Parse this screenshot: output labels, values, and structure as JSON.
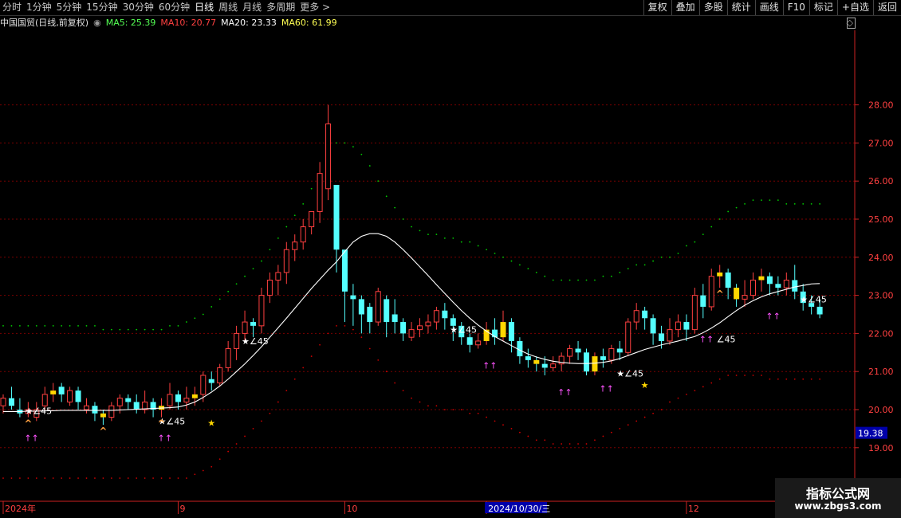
{
  "toolbar": {
    "periods": [
      "分时",
      "1分钟",
      "5分钟",
      "15分钟",
      "30分钟",
      "60分钟",
      "日线",
      "周线",
      "月线",
      "多周期",
      "更多 >"
    ],
    "active_index": 6,
    "tools": [
      "复权",
      "叠加",
      "多股",
      "统计",
      "画线",
      "F10",
      "标记",
      "+自选",
      "返回"
    ]
  },
  "info": {
    "stock": "中国国贸(日线,前复权)",
    "ma5": "MA5: 25.39",
    "ma10": "MA10: 20.77",
    "ma20": "MA20: 23.33",
    "ma60": "MA60: 61.99"
  },
  "watermark": {
    "line1": "指标公式网",
    "line2": "www.zbgs3.com"
  },
  "colors": {
    "up": "#ff4040",
    "down": "#54ffff",
    "ma": "#ffffff",
    "upper": "#00cc00",
    "lower": "#cc0000",
    "gold": "#ffd700"
  },
  "chart_data": {
    "type": "candlestick",
    "yaxis": {
      "ticks": [
        19,
        20,
        21,
        22,
        23,
        24,
        25,
        26,
        27,
        28
      ],
      "side": "right"
    },
    "current_price": "19.38",
    "xaxis_labels": [
      {
        "label": "2024年",
        "index": 0
      },
      {
        "label": "9",
        "index": 21
      },
      {
        "label": "10",
        "index": 41
      },
      {
        "label": "2024/10/30/三",
        "index": 58,
        "highlight": true
      },
      {
        "label": "12",
        "index": 82
      }
    ],
    "candles": [
      [
        20.1,
        20.3,
        19.9,
        20.4
      ],
      [
        20.3,
        20.1,
        20.0,
        20.6
      ],
      [
        20.0,
        19.9,
        19.8,
        20.3
      ],
      [
        19.9,
        20.0,
        19.8,
        20.2
      ],
      [
        19.8,
        20.0,
        19.7,
        20.2
      ],
      [
        20.1,
        20.4,
        20.0,
        20.6
      ],
      [
        20.4,
        20.5,
        20.2,
        20.7
      ],
      [
        20.6,
        20.4,
        20.2,
        20.7
      ],
      [
        20.2,
        20.5,
        20.1,
        20.6
      ],
      [
        20.5,
        20.2,
        20.0,
        20.6
      ],
      [
        20.0,
        20.1,
        19.9,
        20.3
      ],
      [
        20.1,
        19.9,
        19.7,
        20.2
      ],
      [
        19.9,
        19.8,
        19.6,
        20.0
      ],
      [
        19.8,
        20.1,
        19.7,
        20.2
      ],
      [
        20.1,
        20.3,
        19.9,
        20.4
      ],
      [
        20.3,
        20.2,
        20.0,
        20.4
      ],
      [
        20.2,
        20.0,
        19.9,
        20.4
      ],
      [
        20.0,
        20.2,
        19.9,
        20.5
      ],
      [
        20.2,
        20.0,
        19.8,
        20.3
      ],
      [
        20.0,
        20.1,
        19.8,
        20.3
      ],
      [
        20.1,
        20.4,
        20.0,
        20.7
      ],
      [
        20.4,
        20.2,
        20.0,
        20.5
      ],
      [
        20.2,
        20.3,
        20.0,
        20.6
      ],
      [
        20.3,
        20.4,
        20.1,
        20.6
      ],
      [
        20.4,
        20.9,
        20.2,
        21.0
      ],
      [
        20.8,
        20.7,
        20.5,
        21.0
      ],
      [
        20.7,
        21.1,
        20.6,
        21.2
      ],
      [
        21.1,
        21.6,
        21.0,
        21.8
      ],
      [
        21.6,
        22.0,
        21.3,
        22.2
      ],
      [
        22.0,
        22.3,
        21.8,
        22.6
      ],
      [
        22.3,
        22.2,
        21.9,
        22.4
      ],
      [
        22.2,
        23.0,
        22.0,
        23.2
      ],
      [
        23.0,
        23.4,
        22.8,
        23.6
      ],
      [
        23.4,
        23.6,
        23.0,
        23.8
      ],
      [
        23.6,
        24.2,
        23.3,
        24.4
      ],
      [
        24.2,
        24.4,
        23.9,
        24.6
      ],
      [
        24.4,
        24.8,
        24.2,
        25.0
      ],
      [
        24.8,
        25.2,
        24.6,
        25.2
      ],
      [
        25.2,
        26.2,
        24.9,
        26.5
      ],
      [
        25.8,
        27.5,
        25.5,
        28.0
      ],
      [
        25.9,
        24.2,
        23.6,
        25.4
      ],
      [
        24.2,
        23.1,
        22.3,
        23.5
      ],
      [
        23.0,
        22.9,
        22.2,
        23.3
      ],
      [
        22.9,
        22.5,
        22.0,
        23.0
      ],
      [
        22.7,
        22.3,
        22.0,
        22.8
      ],
      [
        22.3,
        23.1,
        22.2,
        23.2
      ],
      [
        22.9,
        22.3,
        21.9,
        23.0
      ],
      [
        22.5,
        22.3,
        22.0,
        22.9
      ],
      [
        22.3,
        22.0,
        21.8,
        22.4
      ],
      [
        21.9,
        22.1,
        21.8,
        22.3
      ],
      [
        22.1,
        22.2,
        21.9,
        22.4
      ],
      [
        22.2,
        22.3,
        22.0,
        22.5
      ],
      [
        22.3,
        22.6,
        22.1,
        22.7
      ],
      [
        22.6,
        22.4,
        22.1,
        22.8
      ],
      [
        22.4,
        22.2,
        21.8,
        22.5
      ],
      [
        22.2,
        21.9,
        21.7,
        22.3
      ],
      [
        21.9,
        21.7,
        21.5,
        22.0
      ],
      [
        21.7,
        21.8,
        21.6,
        22.0
      ],
      [
        21.8,
        22.1,
        21.7,
        22.3
      ],
      [
        22.1,
        21.9,
        21.7,
        22.4
      ],
      [
        21.9,
        22.3,
        21.8,
        22.6
      ],
      [
        22.3,
        21.8,
        21.5,
        22.4
      ],
      [
        21.8,
        21.4,
        21.2,
        21.9
      ],
      [
        21.4,
        21.3,
        21.1,
        21.6
      ],
      [
        21.3,
        21.2,
        21.0,
        21.4
      ],
      [
        21.2,
        21.1,
        20.9,
        21.4
      ],
      [
        21.1,
        21.2,
        21.0,
        21.4
      ],
      [
        21.2,
        21.4,
        21.0,
        21.5
      ],
      [
        21.4,
        21.6,
        21.2,
        21.7
      ],
      [
        21.6,
        21.5,
        21.3,
        21.8
      ],
      [
        21.5,
        21.0,
        20.9,
        21.6
      ],
      [
        21.0,
        21.4,
        20.9,
        21.5
      ],
      [
        21.4,
        21.3,
        21.1,
        21.6
      ],
      [
        21.3,
        21.6,
        21.2,
        21.7
      ],
      [
        21.6,
        21.5,
        21.3,
        21.8
      ],
      [
        21.5,
        22.3,
        21.4,
        22.4
      ],
      [
        22.3,
        22.6,
        22.1,
        22.8
      ],
      [
        22.6,
        22.4,
        22.1,
        22.7
      ],
      [
        22.4,
        22.0,
        21.7,
        22.5
      ],
      [
        22.0,
        21.8,
        21.6,
        22.2
      ],
      [
        21.8,
        22.1,
        21.7,
        22.4
      ],
      [
        22.1,
        22.3,
        21.9,
        22.5
      ],
      [
        22.3,
        22.1,
        21.8,
        22.5
      ],
      [
        22.1,
        23.0,
        22.0,
        23.2
      ],
      [
        23.0,
        22.7,
        22.4,
        23.3
      ],
      [
        22.7,
        23.5,
        22.6,
        23.7
      ],
      [
        23.5,
        23.6,
        23.2,
        23.8
      ],
      [
        23.6,
        23.2,
        22.9,
        23.7
      ],
      [
        23.2,
        22.9,
        22.7,
        23.3
      ],
      [
        22.9,
        23.0,
        22.7,
        23.4
      ],
      [
        23.0,
        23.4,
        22.9,
        23.6
      ],
      [
        23.4,
        23.5,
        23.1,
        23.7
      ],
      [
        23.5,
        23.3,
        23.0,
        23.6
      ],
      [
        23.3,
        23.2,
        23.0,
        23.5
      ],
      [
        23.2,
        23.4,
        23.0,
        23.6
      ],
      [
        23.4,
        23.1,
        22.9,
        23.8
      ],
      [
        23.1,
        22.8,
        22.6,
        23.3
      ],
      [
        22.8,
        22.7,
        22.5,
        23.0
      ],
      [
        22.7,
        22.5,
        22.4,
        22.9
      ]
    ],
    "ma_line": [
      19.95,
      19.95,
      19.95,
      19.96,
      19.96,
      19.97,
      19.97,
      19.98,
      19.98,
      19.98,
      19.98,
      19.98,
      19.98,
      19.98,
      19.99,
      20.0,
      20.01,
      20.02,
      20.03,
      20.04,
      20.05,
      20.07,
      20.12,
      20.2,
      20.32,
      20.46,
      20.62,
      20.8,
      21.0,
      21.2,
      21.42,
      21.65,
      21.9,
      22.15,
      22.4,
      22.66,
      22.92,
      23.18,
      23.42,
      23.66,
      23.88,
      24.15,
      24.4,
      24.55,
      24.62,
      24.62,
      24.55,
      24.4,
      24.2,
      23.98,
      23.75,
      23.52,
      23.28,
      23.05,
      22.82,
      22.6,
      22.4,
      22.22,
      22.06,
      21.92,
      21.8,
      21.68,
      21.56,
      21.46,
      21.38,
      21.32,
      21.27,
      21.24,
      21.22,
      21.21,
      21.21,
      21.22,
      21.24,
      21.28,
      21.34,
      21.42,
      21.5,
      21.58,
      21.64,
      21.7,
      21.75,
      21.8,
      21.86,
      21.92,
      22.02,
      22.14,
      22.28,
      22.44,
      22.6,
      22.74,
      22.86,
      22.96,
      23.04,
      23.1,
      23.16,
      23.22,
      23.26,
      23.3,
      23.31
    ],
    "upper_band": [
      22.2,
      22.2,
      22.2,
      22.2,
      22.2,
      22.2,
      22.2,
      22.2,
      22.2,
      22.2,
      22.2,
      22.2,
      22.1,
      22.1,
      22.1,
      22.1,
      22.1,
      22.1,
      22.1,
      22.1,
      22.2,
      22.2,
      22.3,
      22.4,
      22.5,
      22.7,
      22.9,
      23.1,
      23.3,
      23.5,
      23.7,
      23.9,
      24.2,
      24.5,
      24.8,
      25.1,
      25.4,
      25.8,
      26.2,
      26.6,
      27.0,
      27.0,
      26.9,
      26.7,
      26.4,
      26.0,
      25.6,
      25.3,
      25.0,
      24.8,
      24.7,
      24.6,
      24.6,
      24.5,
      24.5,
      24.4,
      24.4,
      24.3,
      24.2,
      24.1,
      24.0,
      23.9,
      23.8,
      23.7,
      23.6,
      23.5,
      23.4,
      23.4,
      23.4,
      23.4,
      23.4,
      23.4,
      23.5,
      23.5,
      23.6,
      23.7,
      23.8,
      23.8,
      23.9,
      24.0,
      24.0,
      24.1,
      24.3,
      24.4,
      24.6,
      24.8,
      25.0,
      25.2,
      25.3,
      25.4,
      25.5,
      25.5,
      25.5,
      25.5,
      25.4,
      25.4,
      25.4,
      25.4,
      25.4
    ],
    "lower_band": [
      18.2,
      18.2,
      18.2,
      18.2,
      18.2,
      18.2,
      18.2,
      18.2,
      18.2,
      18.2,
      18.2,
      18.2,
      18.2,
      18.2,
      18.2,
      18.2,
      18.2,
      18.2,
      18.2,
      18.2,
      18.2,
      18.2,
      18.2,
      18.3,
      18.4,
      18.5,
      18.7,
      18.9,
      19.1,
      19.3,
      19.5,
      19.7,
      19.9,
      20.2,
      20.5,
      20.8,
      21.1,
      21.4,
      21.7,
      22.0,
      22.2,
      22.2,
      22.1,
      21.9,
      21.6,
      21.3,
      21.0,
      20.7,
      20.5,
      20.3,
      20.2,
      20.1,
      20.1,
      20.0,
      20.0,
      20.0,
      19.9,
      19.9,
      19.8,
      19.7,
      19.6,
      19.5,
      19.4,
      19.3,
      19.2,
      19.2,
      19.1,
      19.1,
      19.1,
      19.1,
      19.1,
      19.2,
      19.3,
      19.4,
      19.5,
      19.6,
      19.7,
      19.8,
      19.9,
      20.0,
      20.2,
      20.3,
      20.4,
      20.5,
      20.6,
      20.7,
      20.8,
      20.9,
      20.9,
      20.9,
      20.9,
      20.9,
      20.8,
      20.8,
      20.8,
      20.8,
      20.8,
      20.8,
      20.8
    ],
    "gold_bars": [
      6,
      12,
      19,
      23,
      58,
      60,
      64,
      71,
      86,
      88,
      91
    ],
    "signals": [
      {
        "index": 3,
        "label": "★∠45",
        "price": 19.97
      },
      {
        "index": 19,
        "label": "★∠45",
        "price": 19.7
      },
      {
        "index": 29,
        "label": "★∠45",
        "price": 21.8
      },
      {
        "index": 54,
        "label": "★∠45",
        "price": 22.1
      },
      {
        "index": 74,
        "label": "★∠45",
        "price": 20.95
      },
      {
        "index": 86,
        "label": "∠45",
        "price": 21.85
      },
      {
        "index": 96,
        "label": "★∠45",
        "price": 22.9
      }
    ],
    "arrows": [
      3,
      19,
      58,
      67,
      72,
      84,
      92
    ],
    "caret_marks": [
      3,
      12,
      19,
      86
    ],
    "stars": [
      {
        "index": 25,
        "price": 19.65
      },
      {
        "index": 77,
        "price": 20.65
      }
    ]
  }
}
